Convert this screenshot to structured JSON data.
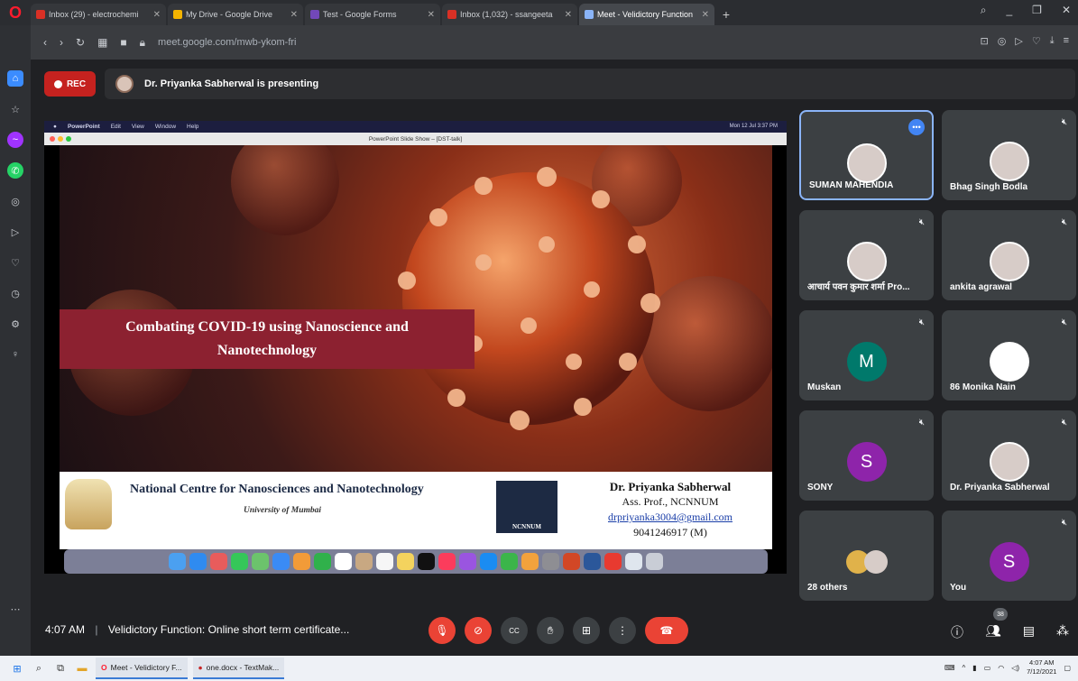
{
  "browser": {
    "tabs": [
      {
        "label": "Inbox (29) - electrochemi",
        "color": "#d93025"
      },
      {
        "label": "My Drive - Google Drive",
        "color": "#f4b400"
      },
      {
        "label": "Test - Google Forms",
        "color": "#7248b9"
      },
      {
        "label": "Inbox (1,032) - ssangeeta",
        "color": "#d93025"
      },
      {
        "label": "Meet - Velidictory Function",
        "color": "#8ab4f8"
      }
    ],
    "new_tab": "+",
    "url": "meet.google.com/mwb-ykom-fri"
  },
  "meet": {
    "rec_label": "REC",
    "presenting_text": "Dr. Priyanka Sabherwal is presenting",
    "shared_screen": {
      "mac_menu": [
        "PowerPoint",
        "Edit",
        "View",
        "Window",
        "Help"
      ],
      "mac_clock": "Mon 12 Jul  3:37 PM",
      "ppt_window_title": "PowerPoint Slide Show – [DST-talk]",
      "slide_title_line1": "Combating COVID-19 using Nanoscience and",
      "slide_title_line2": "Nanotechnology",
      "institute": "National Centre for Nanosciences and Nanotechnology",
      "university": "University of Mumbai",
      "logo_text": "NCNNUM",
      "presenter_name": "Dr. Priyanka Sabherwal",
      "presenter_role": "Ass. Prof., NCNNUM",
      "presenter_email": "drpriyanka3004@gmail.com",
      "presenter_phone": "9041246917 (M)"
    },
    "participants": [
      {
        "name": "SUMAN MAHENDIA",
        "avatar": "photo",
        "selected": true
      },
      {
        "name": "Bhag Singh Bodla",
        "avatar": "photo"
      },
      {
        "name": "आचार्य पवन कुमार शर्मा Pro...",
        "avatar": "photo"
      },
      {
        "name": "ankita agrawal",
        "avatar": "photo"
      },
      {
        "name": "Muskan",
        "avatar": "M",
        "color": "#00796b"
      },
      {
        "name": "86 Monika Nain",
        "avatar": "blank"
      },
      {
        "name": "SONY",
        "avatar": "S",
        "color": "#8e24aa"
      },
      {
        "name": "Dr. Priyanka Sabherwal",
        "avatar": "photo"
      },
      {
        "name": "28 others",
        "avatar": "group"
      },
      {
        "name": "You",
        "avatar": "S",
        "color": "#8e24aa"
      }
    ],
    "time": "4:07 AM",
    "meeting_title": "Velidictory Function: Online short term certificate...",
    "participant_count": "38"
  },
  "taskbar": {
    "apps": [
      "Meet - Velidictory F...",
      "one.docx - TextMak..."
    ],
    "clock_time": "4:07 AM",
    "clock_date": "7/12/2021"
  }
}
